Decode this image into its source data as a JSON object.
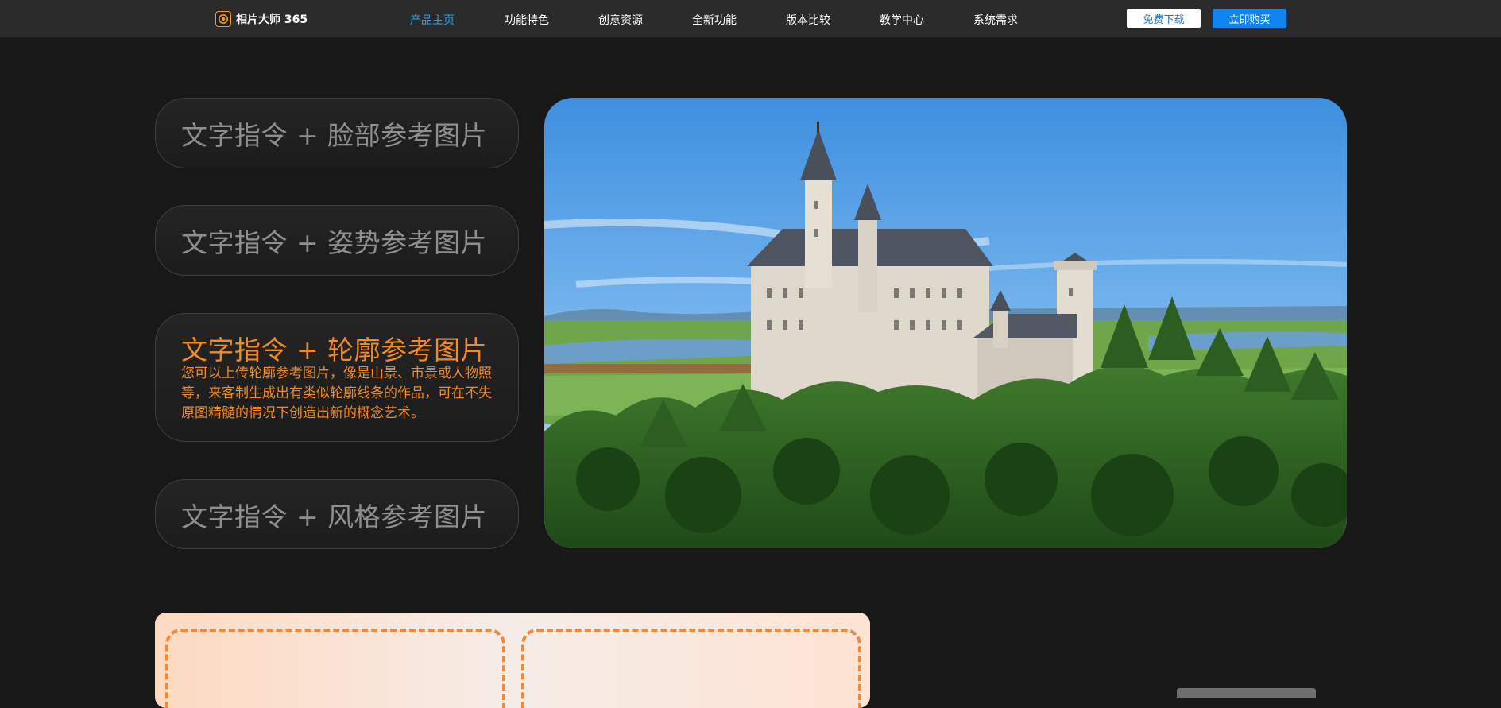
{
  "brand": {
    "name": "相片大师 365",
    "logo_icon": "camera-aperture-icon",
    "accent": "#f59a23"
  },
  "nav": {
    "items": [
      {
        "label": "产品主页",
        "active": true
      },
      {
        "label": "功能特色",
        "active": false
      },
      {
        "label": "创意资源",
        "active": false
      },
      {
        "label": "全新功能",
        "active": false
      },
      {
        "label": "版本比较",
        "active": false
      },
      {
        "label": "教学中心",
        "active": false
      },
      {
        "label": "系统需求",
        "active": false
      }
    ],
    "download_label": "免费下载",
    "buy_label": "立即购买",
    "active_color": "#2f9ff0"
  },
  "features": {
    "active_index": 2,
    "items": [
      {
        "title": "文字指令 + 脸部参考图片",
        "desc": ""
      },
      {
        "title": "文字指令 + 姿势参考图片",
        "desc": ""
      },
      {
        "title": "文字指令 + 轮廓参考图片",
        "desc": "您可以上传轮廓参考图片，像是山景、市景或人物照等，来客制生成出有类似轮廓线条的作品，可在不失原图精髓的情况下创造出新的概念艺术。"
      },
      {
        "title": "文字指令 + 风格参考图片",
        "desc": ""
      }
    ],
    "accent_color": "#f28a26"
  },
  "hero": {
    "image_subject": "castle-on-hill-landscape-image"
  },
  "colors": {
    "background": "#181818",
    "navbar": "#2b2b2b",
    "buy_button": "#0f85f0"
  }
}
